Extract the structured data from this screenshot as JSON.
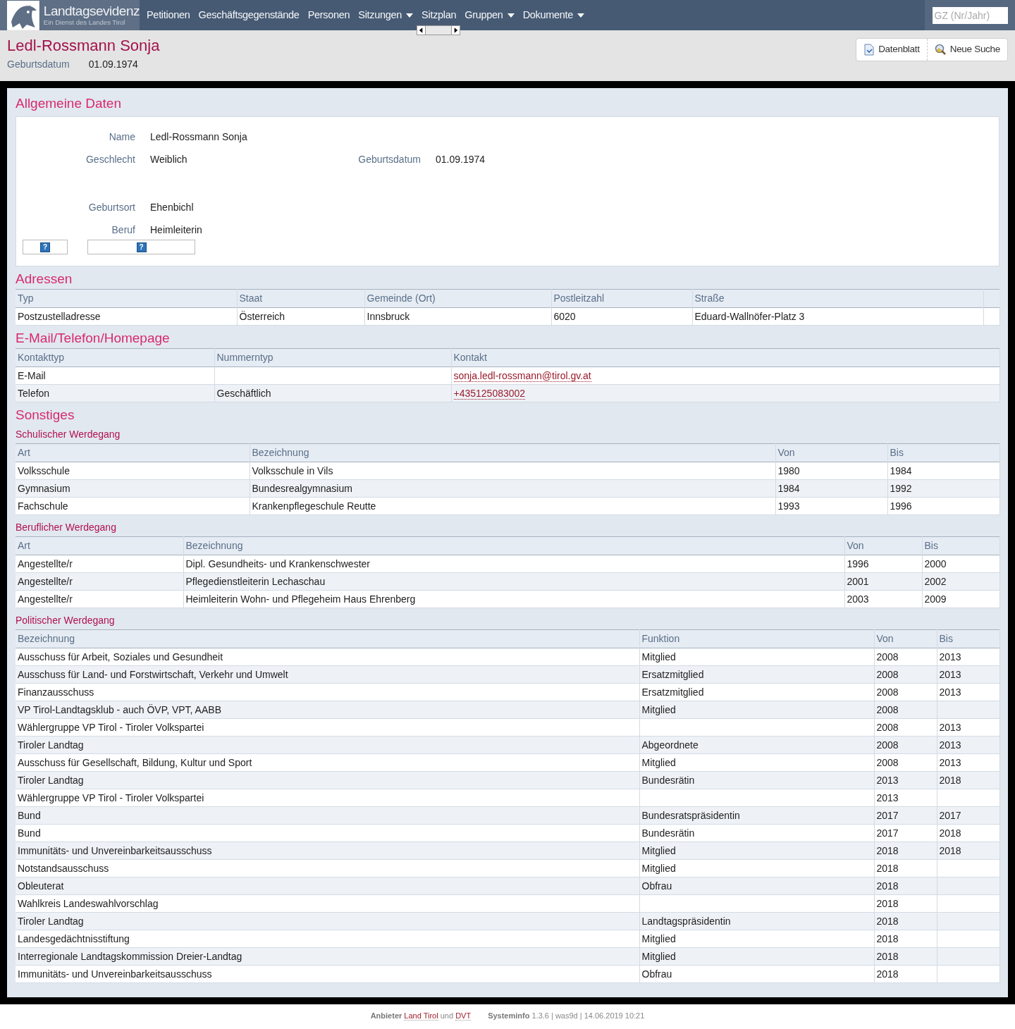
{
  "nav": {
    "brand": "Landtagsevidenz",
    "tagline": "Ein Dienst des Landes Tirol",
    "items": [
      {
        "label": "Petitionen",
        "dropdown": false
      },
      {
        "label": "Geschäftsgegenstände",
        "dropdown": false
      },
      {
        "label": "Personen",
        "dropdown": false
      },
      {
        "label": "Sitzungen",
        "dropdown": true
      },
      {
        "label": "Sitzplan",
        "dropdown": false
      },
      {
        "label": "Gruppen",
        "dropdown": true
      },
      {
        "label": "Dokumente",
        "dropdown": true
      }
    ],
    "search": {
      "placeholder": "GZ (Nr/Jahr)"
    }
  },
  "header": {
    "title": "Ledl-Rossmann Sonja",
    "meta_label": "Geburtsdatum",
    "meta_value": "01.09.1974",
    "buttons": [
      {
        "label": "Datenblatt",
        "kind": "datasheet"
      },
      {
        "label": "Neue Suche",
        "kind": "search"
      }
    ]
  },
  "general": {
    "title": "Allgemeine Daten",
    "rows": [
      [
        {
          "label": "Name",
          "value": "Ledl-Rossmann Sonja"
        }
      ],
      [
        {
          "label": "Geschlecht",
          "value": "Weiblich"
        },
        {
          "label": "Geburtsdatum",
          "value": "01.09.1974"
        }
      ],
      [
        {
          "label": "Geburtsort",
          "value": "Ehenbichl"
        }
      ],
      [
        {
          "label": "Beruf",
          "value": "Heimleiterin"
        }
      ]
    ],
    "help_buttons": [
      "?",
      "?"
    ]
  },
  "addresses": {
    "title": "Adressen",
    "columns": [
      "Typ",
      "Staat",
      "Gemeinde (Ort)",
      "Postleitzahl",
      "Straße"
    ],
    "rows": [
      [
        "Postzustelladresse",
        "Österreich",
        "Innsbruck",
        "6020",
        "Eduard-Wallnöfer-Platz 3"
      ]
    ]
  },
  "contacts": {
    "title": "E-Mail/Telefon/Homepage",
    "columns": [
      {
        "label": "Kontakttyp",
        "kind": "text"
      },
      {
        "label": "Nummerntyp",
        "kind": "text"
      },
      {
        "label": "Kontakt",
        "kind": "link"
      }
    ],
    "rows": [
      [
        "E-Mail",
        null,
        "sonja.ledl-rossmann@tirol.gv.at"
      ],
      [
        "Telefon",
        "Geschäftlich",
        "+435125083002"
      ]
    ]
  },
  "misc": {
    "title": "Sonstiges",
    "school": {
      "title": "Schulischer Werdegang",
      "columns": [
        "Art",
        "Bezeichnung",
        "Von",
        "Bis"
      ],
      "rows": [
        [
          "Volksschule",
          "Volksschule in Vils",
          "1980",
          "1984"
        ],
        [
          "Gymnasium",
          "Bundesrealgymnasium",
          "1984",
          "1992"
        ],
        [
          "Fachschule",
          "Krankenpflegeschule Reutte",
          "1993",
          "1996"
        ]
      ]
    },
    "career": {
      "title": "Beruflicher Werdegang",
      "columns": [
        "Art",
        "Bezeichnung",
        "Von",
        "Bis"
      ],
      "rows": [
        [
          "Angestellte/r",
          "Dipl. Gesundheits- und Krankenschwester",
          "1996",
          "2000"
        ],
        [
          "Angestellte/r",
          "Pflegedienstleiterin Lechaschau",
          "2001",
          "2002"
        ],
        [
          "Angestellte/r",
          "Heimleiterin Wohn- und Pflegeheim Haus Ehrenberg",
          "2003",
          "2009"
        ]
      ]
    },
    "politics": {
      "title": "Politischer Werdegang",
      "columns": [
        "Bezeichnung",
        "Funktion",
        "Von",
        "Bis"
      ],
      "rows": [
        [
          "Ausschuss für Arbeit, Soziales und Gesundheit",
          "Mitglied",
          "2008",
          "2013"
        ],
        [
          "Ausschuss für Land- und Forstwirtschaft, Verkehr und Umwelt",
          "Ersatzmitglied",
          "2008",
          "2013"
        ],
        [
          "Finanzausschuss",
          "Ersatzmitglied",
          "2008",
          "2013"
        ],
        [
          "VP Tirol-Landtagsklub - auch ÖVP, VPT, AABB",
          "Mitglied",
          "2008",
          null
        ],
        [
          "Wählergruppe VP Tirol - Tiroler Volkspartei",
          null,
          "2008",
          "2013"
        ],
        [
          "Tiroler Landtag",
          "Abgeordnete",
          "2008",
          "2013"
        ],
        [
          "Ausschuss für Gesellschaft, Bildung, Kultur und Sport",
          "Mitglied",
          "2008",
          "2013"
        ],
        [
          "Tiroler Landtag",
          "Bundesrätin",
          "2013",
          "2018"
        ],
        [
          "Wählergruppe VP Tirol - Tiroler Volkspartei",
          null,
          "2013",
          null
        ],
        [
          "Bund",
          "Bundesratspräsidentin",
          "2017",
          "2017"
        ],
        [
          "Bund",
          "Bundesrätin",
          "2017",
          "2018"
        ],
        [
          "Immunitäts- und Unvereinbarkeitsausschuss",
          "Mitglied",
          "2018",
          "2018"
        ],
        [
          "Notstandsausschuss",
          "Mitglied",
          "2018",
          null
        ],
        [
          "Obleuterat",
          "Obfrau",
          "2018",
          null
        ],
        [
          "Wahlkreis Landeswahlvorschlag",
          null,
          "2018",
          null
        ],
        [
          "Tiroler Landtag",
          "Landtagspräsidentin",
          "2018",
          null
        ],
        [
          "Landesgedächtnisstiftung",
          "Mitglied",
          "2018",
          null
        ],
        [
          "Interregionale Landtagskommission Dreier-Landtag",
          "Mitglied",
          "2018",
          null
        ],
        [
          "Immunitäts- und Unvereinbarkeitsausschuss",
          "Obfrau",
          "2018",
          null
        ]
      ]
    }
  },
  "footer": {
    "provider_label": "Anbieter",
    "provider_links": [
      "Land Tirol",
      "DVT"
    ],
    "joiner": "und",
    "system_label": "Systeminfo",
    "system_text": "1.3.6 | was9d | 14.06.2019 10:21"
  }
}
